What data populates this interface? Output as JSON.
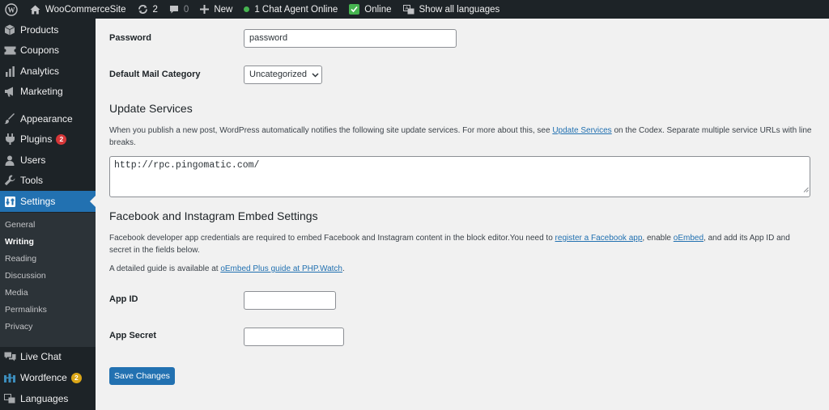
{
  "admin_bar": {
    "site_name": "WooCommerceSite",
    "updates_count": "2",
    "comments_count": "0",
    "new_label": "New",
    "chat_status": "1 Chat Agent Online",
    "online_label": "Online",
    "languages_label": "Show all languages"
  },
  "sidebar": {
    "items": [
      {
        "label": "Products"
      },
      {
        "label": "Coupons"
      },
      {
        "label": "Analytics"
      },
      {
        "label": "Marketing"
      },
      {
        "label": "Appearance"
      },
      {
        "label": "Plugins",
        "badge": "2"
      },
      {
        "label": "Users"
      },
      {
        "label": "Tools"
      },
      {
        "label": "Settings"
      },
      {
        "label": "Live Chat"
      },
      {
        "label": "Wordfence",
        "badge": "2"
      },
      {
        "label": "Languages"
      }
    ],
    "submenu": [
      "General",
      "Writing",
      "Reading",
      "Discussion",
      "Media",
      "Permalinks",
      "Privacy"
    ]
  },
  "form": {
    "password_label": "Password",
    "password_value": "password",
    "mail_category_label": "Default Mail Category",
    "mail_category_value": "Uncategorized",
    "update_services": {
      "heading": "Update Services",
      "desc_before": "When you publish a new post, WordPress automatically notifies the following site update services. For more about this, see ",
      "desc_link": "Update Services",
      "desc_after": " on the Codex. Separate multiple service URLs with line breaks.",
      "textarea_value": "http://rpc.pingomatic.com/"
    },
    "embed": {
      "heading": "Facebook and Instagram Embed Settings",
      "desc1_before": "Facebook developer app credentials are required to embed Facebook and Instagram content in the block editor.You need to ",
      "desc1_link1": "register a Facebook app",
      "desc1_mid": ", enable ",
      "desc1_link2": "oEmbed",
      "desc1_after": ", and add its App ID and secret in the fields below.",
      "desc2_before": "A detailed guide is available at ",
      "desc2_link": "oEmbed Plus guide at PHP.Watch",
      "desc2_after": ".",
      "app_id_label": "App ID",
      "app_id_value": "",
      "app_secret_label": "App Secret",
      "app_secret_value": ""
    },
    "save_label": "Save Changes"
  },
  "colors": {
    "admin_bg": "#1d2327",
    "accent": "#2271b1",
    "badge_red": "#d63638",
    "badge_yellow": "#dba617",
    "online_green": "#46b450"
  }
}
